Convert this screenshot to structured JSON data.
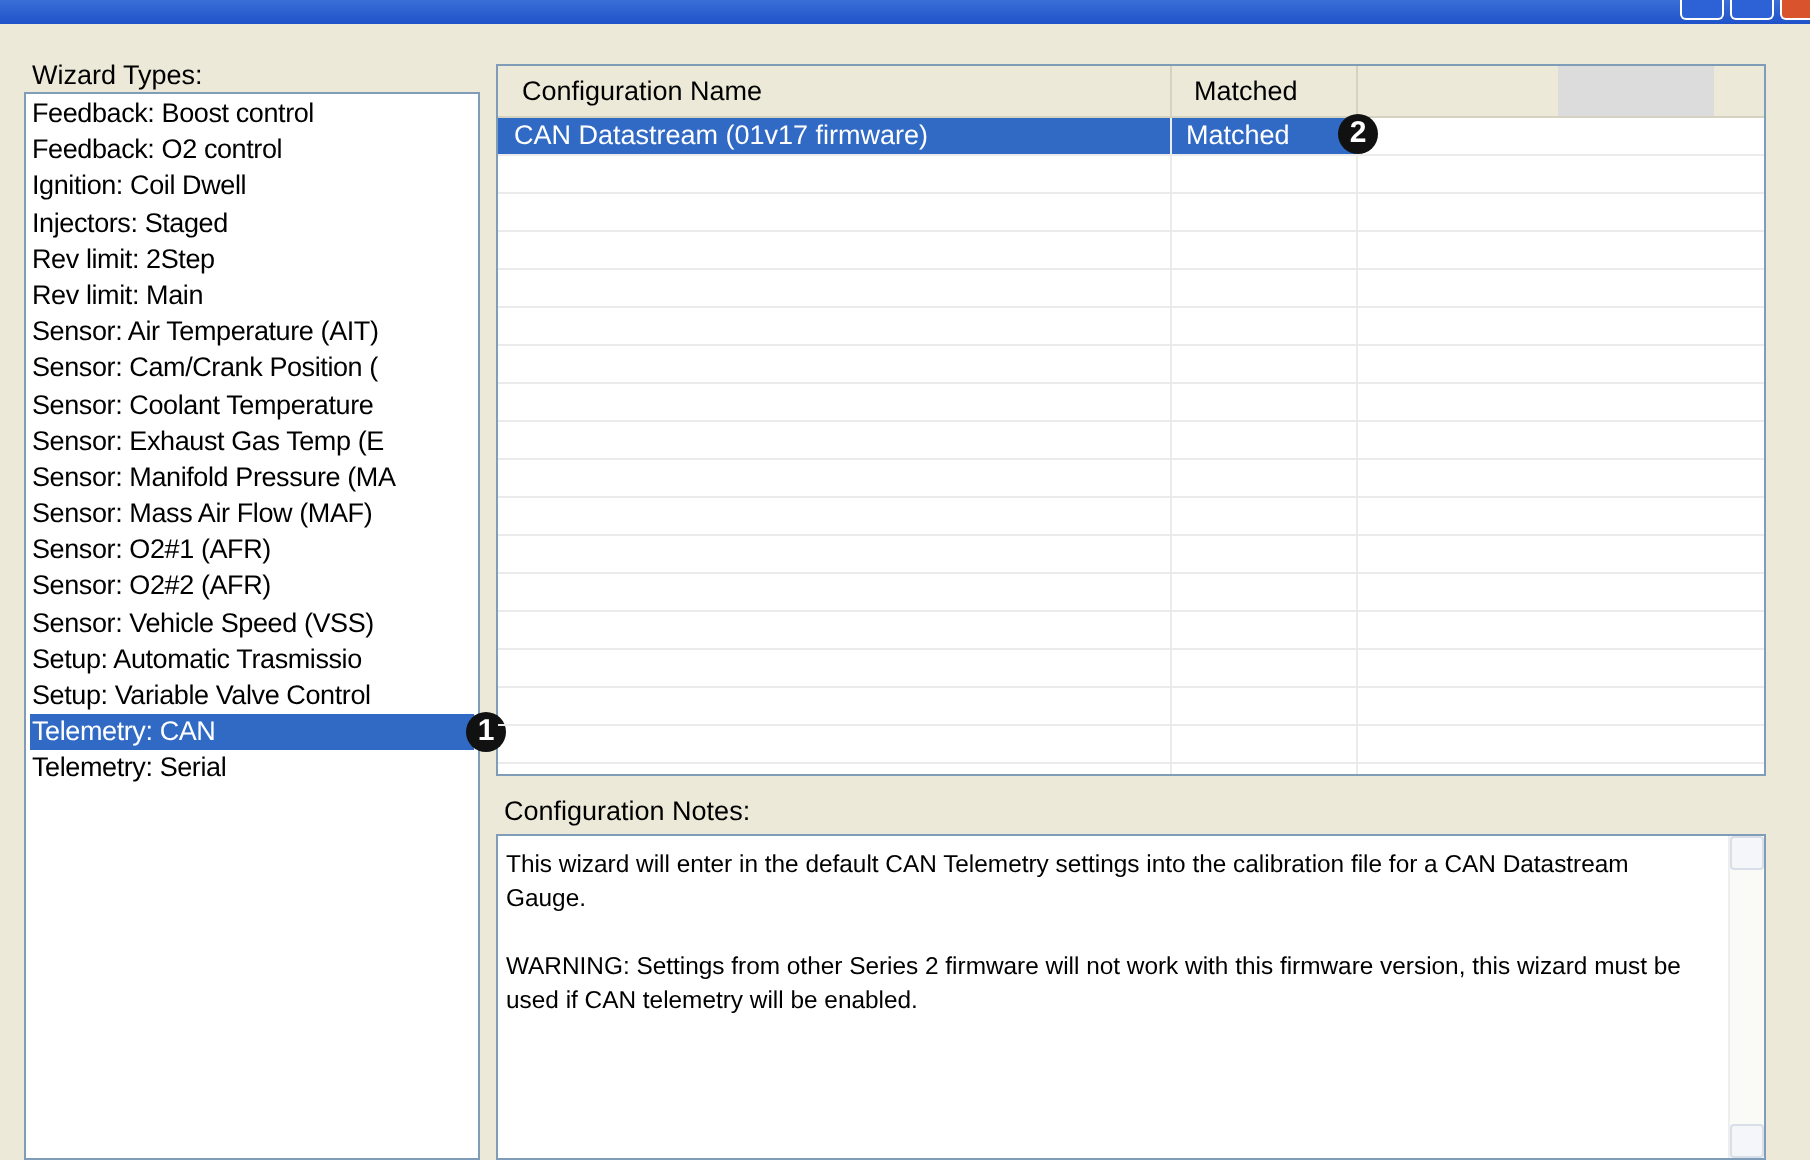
{
  "wizard_types": {
    "label": "Wizard Types:",
    "items": [
      {
        "label": "Feedback: Boost control",
        "selected": false
      },
      {
        "label": "Feedback: O2 control",
        "selected": false
      },
      {
        "label": "Ignition: Coil Dwell",
        "selected": false
      },
      {
        "label": "Injectors: Staged",
        "selected": false
      },
      {
        "label": "Rev limit: 2Step",
        "selected": false
      },
      {
        "label": "Rev limit: Main",
        "selected": false
      },
      {
        "label": "Sensor: Air Temperature (AIT)",
        "selected": false
      },
      {
        "label": "Sensor: Cam/Crank Position (",
        "selected": false
      },
      {
        "label": "Sensor: Coolant Temperature",
        "selected": false
      },
      {
        "label": "Sensor: Exhaust Gas Temp (E",
        "selected": false
      },
      {
        "label": "Sensor: Manifold Pressure (MA",
        "selected": false
      },
      {
        "label": "Sensor: Mass Air Flow (MAF)",
        "selected": false
      },
      {
        "label": "Sensor: O2#1 (AFR)",
        "selected": false
      },
      {
        "label": "Sensor: O2#2 (AFR)",
        "selected": false
      },
      {
        "label": "Sensor: Vehicle Speed (VSS)",
        "selected": false
      },
      {
        "label": "Setup: Automatic Trasmissio",
        "selected": false
      },
      {
        "label": "Setup: Variable Valve Control",
        "selected": false
      },
      {
        "label": "Telemetry: CAN",
        "selected": true,
        "callout": "1"
      },
      {
        "label": "Telemetry: Serial",
        "selected": false
      }
    ]
  },
  "configurations": {
    "columns": [
      "Configuration Name",
      "Matched"
    ],
    "rows": [
      {
        "cells": [
          "CAN Datastream (01v17 firmware)",
          "Matched"
        ],
        "selected": true,
        "callout": "2"
      }
    ]
  },
  "notes": {
    "label": "Configuration Notes:",
    "paragraphs": [
      "This wizard will enter in the default CAN Telemetry settings into the calibration file for a CAN Datastream Gauge.",
      "WARNING: Settings from other Series 2 firmware will not work with this firmware version, this wizard must be used if CAN telemetry will be enabled."
    ]
  }
}
